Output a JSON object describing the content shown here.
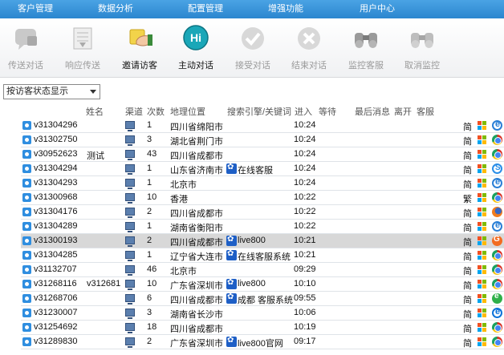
{
  "menu": [
    "客户管理",
    "数据分析",
    "配置管理",
    "增强功能",
    "用户中心"
  ],
  "toolbar": [
    {
      "label": "传送对话",
      "icon": "transfer-chat-icon",
      "active": false
    },
    {
      "label": "响应传送",
      "icon": "respond-transfer-icon",
      "active": false
    },
    {
      "label": "邀请访客",
      "icon": "invite-visitor-icon",
      "active": true
    },
    {
      "label": "主动对话",
      "icon": "active-chat-hi-icon",
      "active": true
    },
    {
      "label": "接受对话",
      "icon": "accept-chat-icon",
      "active": false
    },
    {
      "label": "结束对话",
      "icon": "end-chat-icon",
      "active": false
    },
    {
      "label": "监控客服",
      "icon": "monitor-agent-icon",
      "active": false
    },
    {
      "label": "取消监控",
      "icon": "cancel-monitor-icon",
      "active": false
    }
  ],
  "filter": {
    "value": "按访客状态显示"
  },
  "columns": [
    "姓名",
    "渠道",
    "次数",
    "地理位置",
    "搜索引擎/关键词",
    "进入",
    "等待",
    "最后消息",
    "离开",
    "客服"
  ],
  "rows": [
    {
      "id": "v31304296",
      "name": "",
      "count": "1",
      "location": "四川省绵阳市",
      "keyword": "",
      "enter": "10:24",
      "lang": "简",
      "browser": "ie",
      "selected": false
    },
    {
      "id": "v31302750",
      "name": "",
      "count": "3",
      "location": "湖北省荆门市",
      "keyword": "",
      "enter": "10:24",
      "lang": "简",
      "browser": "chrome",
      "selected": false
    },
    {
      "id": "v30952623",
      "name": "测试",
      "count": "43",
      "location": "四川省成都市",
      "keyword": "",
      "enter": "10:24",
      "lang": "简",
      "browser": "chrome",
      "selected": false
    },
    {
      "id": "v31304294",
      "name": "",
      "count": "1",
      "location": "山东省济南市",
      "keyword": "在线客服",
      "enter": "10:24",
      "lang": "简",
      "browser": "sogou",
      "selected": false
    },
    {
      "id": "v31304293",
      "name": "",
      "count": "1",
      "location": "北京市",
      "keyword": "",
      "enter": "10:24",
      "lang": "简",
      "browser": "ie",
      "selected": false
    },
    {
      "id": "v31300968",
      "name": "",
      "count": "10",
      "location": "香港",
      "keyword": "",
      "enter": "10:22",
      "lang": "繁",
      "browser": "chrome",
      "selected": false
    },
    {
      "id": "v31304176",
      "name": "",
      "count": "2",
      "location": "四川省成都市",
      "keyword": "",
      "enter": "10:22",
      "lang": "简",
      "browser": "firefox",
      "selected": false
    },
    {
      "id": "v31304289",
      "name": "",
      "count": "1",
      "location": "湖南省衡阳市",
      "keyword": "",
      "enter": "10:22",
      "lang": "简",
      "browser": "ie",
      "selected": false
    },
    {
      "id": "v31300193",
      "name": "",
      "count": "2",
      "location": "四川省成都市",
      "keyword": "live800",
      "enter": "10:21",
      "lang": "简",
      "browser": "uc",
      "selected": true
    },
    {
      "id": "v31304285",
      "name": "",
      "count": "1",
      "location": "辽宁省大连市",
      "keyword": "在线客服系统",
      "enter": "10:21",
      "lang": "简",
      "browser": "chrome",
      "selected": false
    },
    {
      "id": "v31132707",
      "name": "",
      "count": "46",
      "location": "北京市",
      "keyword": "",
      "enter": "09:29",
      "lang": "简",
      "browser": "chrome",
      "selected": false
    },
    {
      "id": "v31268116",
      "name": "v312681",
      "count": "10",
      "location": "广东省深圳市",
      "keyword": "live800",
      "enter": "10:10",
      "lang": "简",
      "browser": "chrome",
      "selected": false
    },
    {
      "id": "v31268706",
      "name": "",
      "count": "6",
      "location": "四川省成都市",
      "keyword": "成都 客服系统",
      "enter": "09:55",
      "lang": "简",
      "browser": "e360",
      "selected": false
    },
    {
      "id": "v31230007",
      "name": "",
      "count": "3",
      "location": "湖南省长沙市",
      "keyword": "",
      "enter": "10:06",
      "lang": "简",
      "browser": "edge",
      "selected": false
    },
    {
      "id": "v31254692",
      "name": "",
      "count": "18",
      "location": "四川省成都市",
      "keyword": "",
      "enter": "10:19",
      "lang": "简",
      "browser": "chrome",
      "selected": false
    },
    {
      "id": "v31289830",
      "name": "",
      "count": "2",
      "location": "广东省深圳市",
      "keyword": "live800官网",
      "enter": "09:17",
      "lang": "简",
      "browser": "chrome",
      "selected": false
    }
  ],
  "colors": {
    "menu_bar": "#3595da",
    "selected_row": "#d8d8d8",
    "accent_blue": "#2f8ee0"
  }
}
